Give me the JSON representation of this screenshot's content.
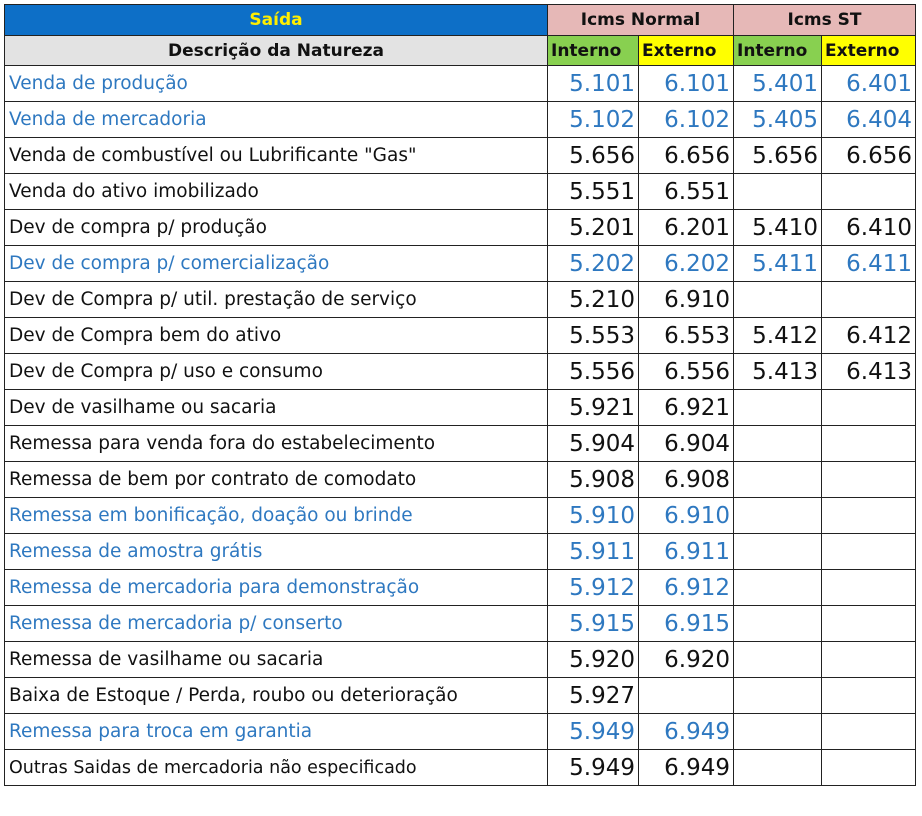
{
  "header": {
    "saida": "Saída",
    "icms_normal": "Icms Normal",
    "icms_st": "Icms ST",
    "descricao": "Descrição da Natureza",
    "interno": "Interno",
    "externo": "Externo",
    "interno_st": "Interno",
    "externo_st": "Externo"
  },
  "colors": {
    "title_bg": "#0d6fc7",
    "title_text": "#ffee00",
    "icms_bg": "#e6b8b7",
    "interno_bg": "#88d050",
    "externo_bg": "#ffff00",
    "blue_text": "#2e78c0"
  },
  "rows": [
    {
      "desc": "Venda de produção",
      "int": "5.101",
      "ext": "6.101",
      "st_int": "5.401",
      "st_ext": "6.401",
      "color": "blue"
    },
    {
      "desc": "Venda de mercadoria",
      "int": "5.102",
      "ext": "6.102",
      "st_int": "5.405",
      "st_ext": "6.404",
      "color": "blue"
    },
    {
      "desc": "Venda de combustível ou Lubrificante \"Gas\"",
      "int": "5.656",
      "ext": "6.656",
      "st_int": "5.656",
      "st_ext": "6.656",
      "color": "black"
    },
    {
      "desc": "Venda do ativo imobilizado",
      "int": "5.551",
      "ext": "6.551",
      "st_int": "",
      "st_ext": "",
      "color": "black"
    },
    {
      "desc": "Dev de compra p/ produção",
      "int": "5.201",
      "ext": "6.201",
      "st_int": "5.410",
      "st_ext": "6.410",
      "color": "black"
    },
    {
      "desc": "Dev de compra p/ comercialização",
      "int": "5.202",
      "ext": "6.202",
      "st_int": "5.411",
      "st_ext": "6.411",
      "color": "blue"
    },
    {
      "desc": "Dev de Compra p/ util. prestação de serviço",
      "int": "5.210",
      "ext": "6.910",
      "st_int": "",
      "st_ext": "",
      "color": "black"
    },
    {
      "desc": "Dev de Compra bem do ativo",
      "int": "5.553",
      "ext": "6.553",
      "st_int": "5.412",
      "st_ext": "6.412",
      "color": "black"
    },
    {
      "desc": "Dev de Compra p/ uso e consumo",
      "int": "5.556",
      "ext": "6.556",
      "st_int": "5.413",
      "st_ext": "6.413",
      "color": "black"
    },
    {
      "desc": "Dev de vasilhame ou sacaria",
      "int": "5.921",
      "ext": "6.921",
      "st_int": "",
      "st_ext": "",
      "color": "black"
    },
    {
      "desc": "Remessa para venda fora do estabelecimento",
      "int": "5.904",
      "ext": "6.904",
      "st_int": "",
      "st_ext": "",
      "color": "black"
    },
    {
      "desc": "Remessa de bem por contrato de comodato",
      "int": "5.908",
      "ext": "6.908",
      "st_int": "",
      "st_ext": "",
      "color": "black"
    },
    {
      "desc": "Remessa em bonificação, doação ou brinde",
      "int": "5.910",
      "ext": "6.910",
      "st_int": "",
      "st_ext": "",
      "color": "blue"
    },
    {
      "desc": "Remessa de amostra grátis",
      "int": "5.911",
      "ext": "6.911",
      "st_int": "",
      "st_ext": "",
      "color": "blue"
    },
    {
      "desc": "Remessa de mercadoria para demonstração",
      "int": "5.912",
      "ext": "6.912",
      "st_int": "",
      "st_ext": "",
      "color": "blue"
    },
    {
      "desc": "Remessa de mercadoria p/ conserto",
      "int": "5.915",
      "ext": "6.915",
      "st_int": "",
      "st_ext": "",
      "color": "blue"
    },
    {
      "desc": "Remessa de vasilhame ou sacaria",
      "int": "5.920",
      "ext": "6.920",
      "st_int": "",
      "st_ext": "",
      "color": "black"
    },
    {
      "desc": "Baixa de Estoque / Perda, roubo ou deterioração",
      "int": "5.927",
      "ext": "",
      "st_int": "",
      "st_ext": "",
      "color": "black"
    },
    {
      "desc": "Remessa para troca em garantia",
      "int": "5.949",
      "ext": "6.949",
      "st_int": "",
      "st_ext": "",
      "color": "blue"
    },
    {
      "desc": "Outras Saidas de mercadoria não especificado",
      "int": "5.949",
      "ext": "6.949",
      "st_int": "",
      "st_ext": "",
      "color": "black",
      "small": true
    }
  ]
}
